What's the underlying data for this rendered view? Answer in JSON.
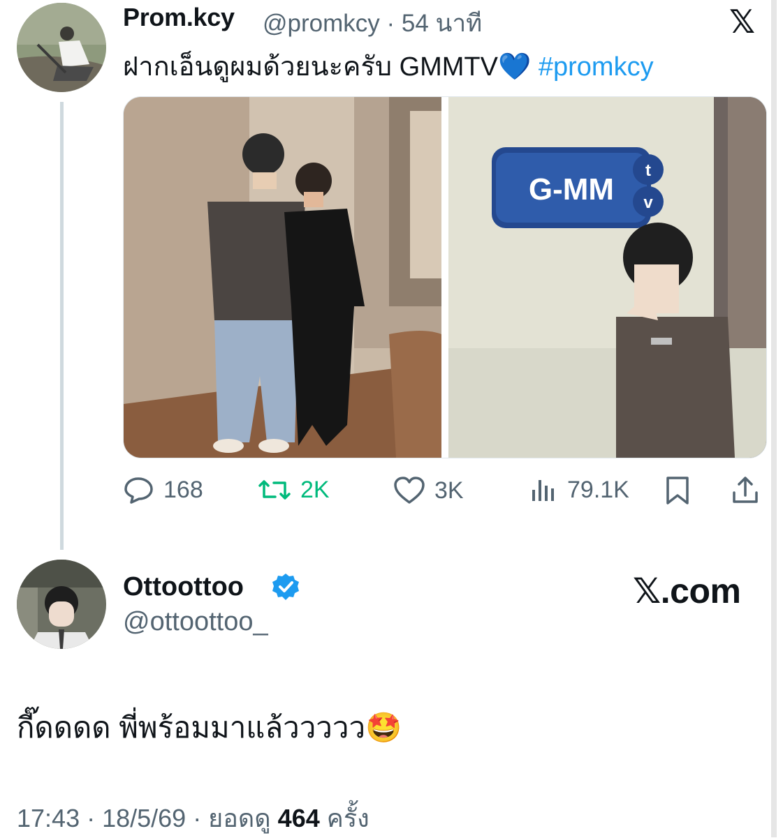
{
  "colors": {
    "accent": "#1d9bf0",
    "retweet": "#00ba7c",
    "muted": "#536471",
    "text": "#0f1419",
    "verified": "#1d9bf0"
  },
  "tweet": {
    "display_name": "Prom.kcy",
    "handle_time": "@promkcy · 54 นาที",
    "text": "ฝากเอ็นดูผมด้วยนะครับ GMMTV💙",
    "hashtag": "#promkcy",
    "logo": "𝕏",
    "images": [
      {
        "description_icon": "photo",
        "logo_text": ""
      },
      {
        "description_icon": "photo",
        "logo_text": "G-MM"
      }
    ],
    "actions": {
      "reply_count": "168",
      "retweet_count": "2K",
      "like_count": "3K",
      "view_count": "79.1K"
    }
  },
  "reply": {
    "display_name": "Ottoottoo",
    "handle": "@ottoottoo_",
    "watermark": "𝕏.com",
    "text": "กี๊ดดดด พี่พร้อมมาแล้ววววว🤩",
    "meta_prefix": "17:43 · 18/5/69 · ยอดดู ",
    "views": "464",
    "meta_suffix": " ครั้ง"
  }
}
